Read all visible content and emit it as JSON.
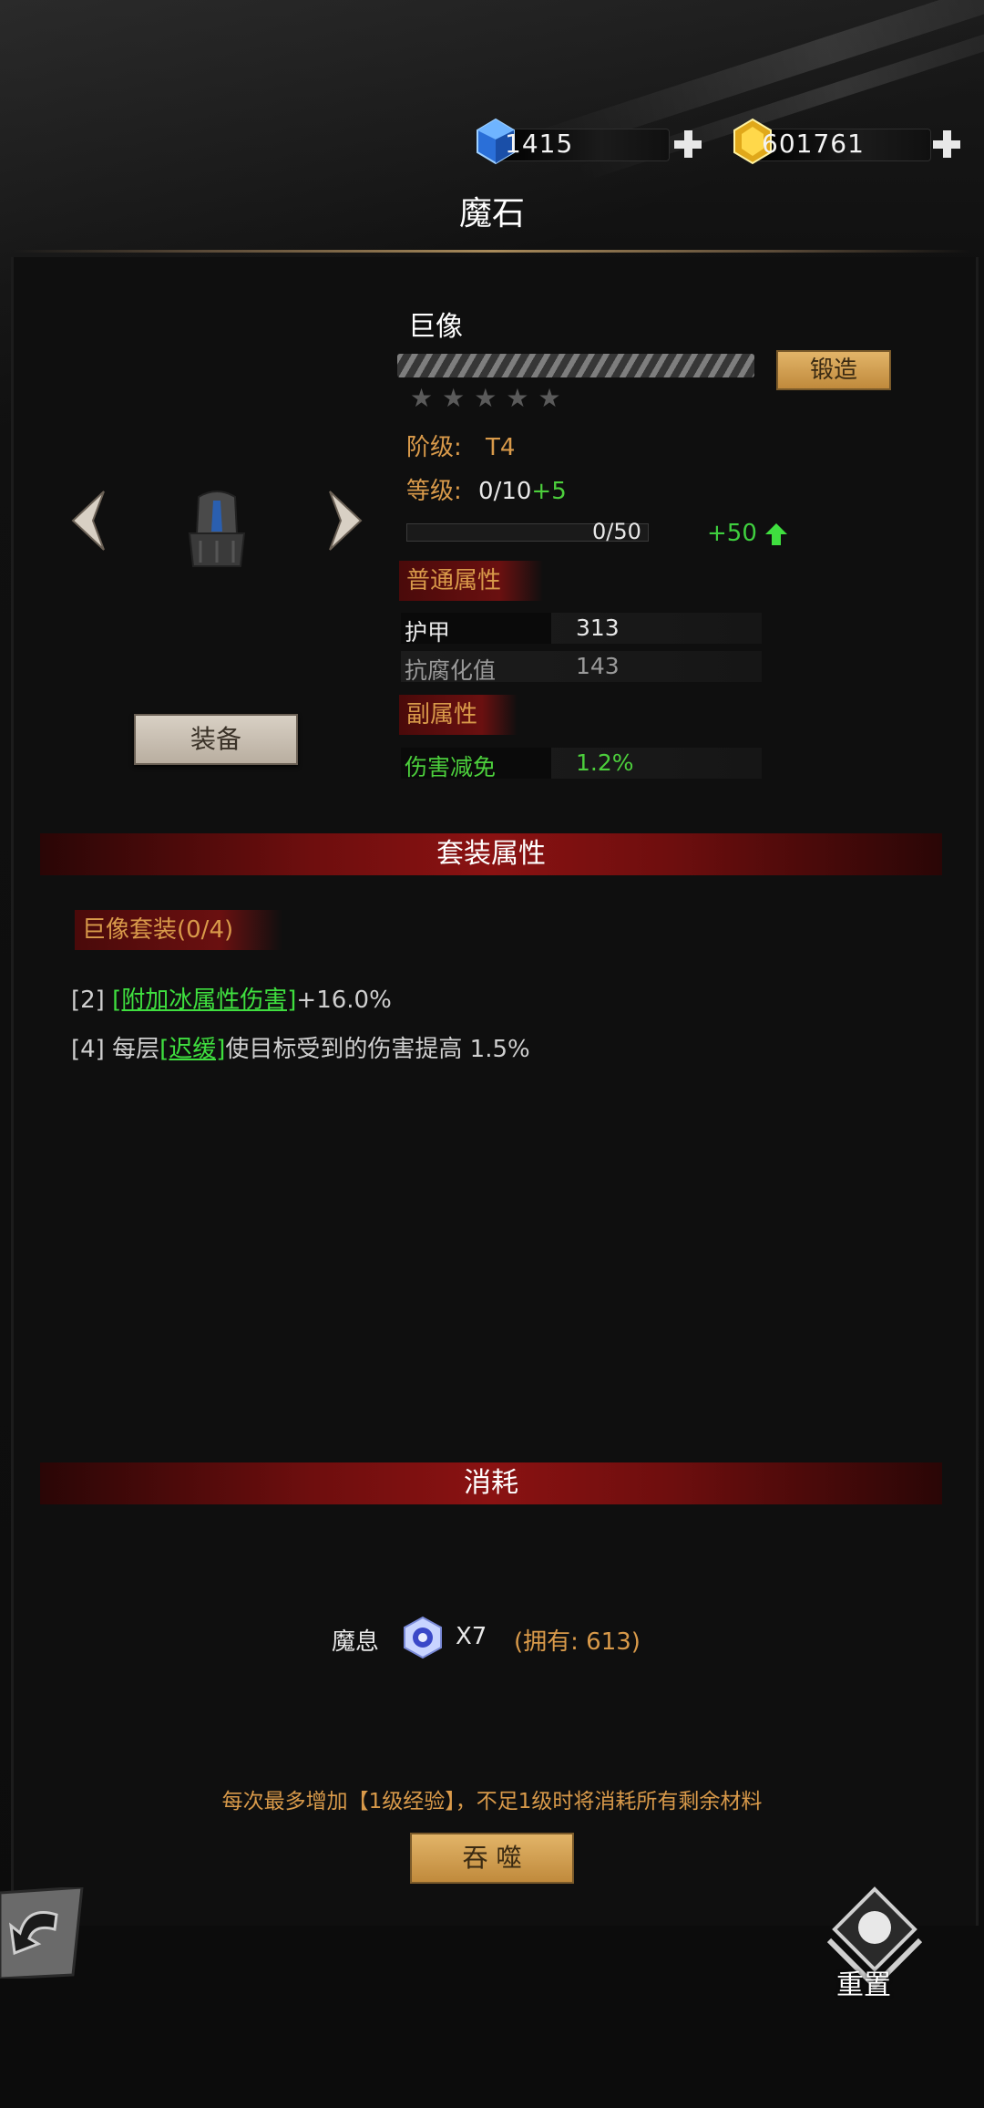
{
  "currency": {
    "gems": "1415",
    "gold": "601761"
  },
  "header": {
    "title": "魔石"
  },
  "item": {
    "name": "巨像",
    "forge_label": "锻造",
    "equip_label": "装备",
    "stars_total": 5,
    "stars_filled": 0,
    "tier_label": "阶级:",
    "tier_value": "T4",
    "level_label": "等级:",
    "level_value": "0/10",
    "level_bonus": "+5",
    "exp_value": "0/50",
    "exp_progress": 0.0,
    "exp_gain": "+50"
  },
  "common_attrs": {
    "title": "普通属性",
    "rows": [
      {
        "name": "护甲",
        "value": "313"
      },
      {
        "name": "抗腐化值",
        "value": "143"
      }
    ]
  },
  "sub_attrs": {
    "title": "副属性",
    "rows": [
      {
        "name": "伤害减免",
        "value": "1.2%"
      }
    ]
  },
  "set": {
    "section_title": "套装属性",
    "name": "巨像套装(0/4)",
    "line1_prefix": "[2]",
    "line1_link": "[附加冰属性伤害]",
    "line1_suffix": "+16.0%",
    "line2_prefix": "[4] 每层",
    "line2_link": "[迟缓]",
    "line2_suffix": "使目标受到的伤害提高 1.5%"
  },
  "consume": {
    "section_title": "消耗",
    "material_name": "魔息",
    "quantity": "X7",
    "owned": "(拥有: 613)",
    "note": "每次最多增加【1级经验】，不足1级时将消耗所有剩余材料",
    "devour_label": "吞 噬"
  },
  "footer": {
    "reset_label": "重置"
  },
  "colors": {
    "accent_orange": "#d99a4a",
    "green": "#4ccf3c",
    "red_bar": "#8a1212",
    "gold_button": "#e2b468"
  }
}
